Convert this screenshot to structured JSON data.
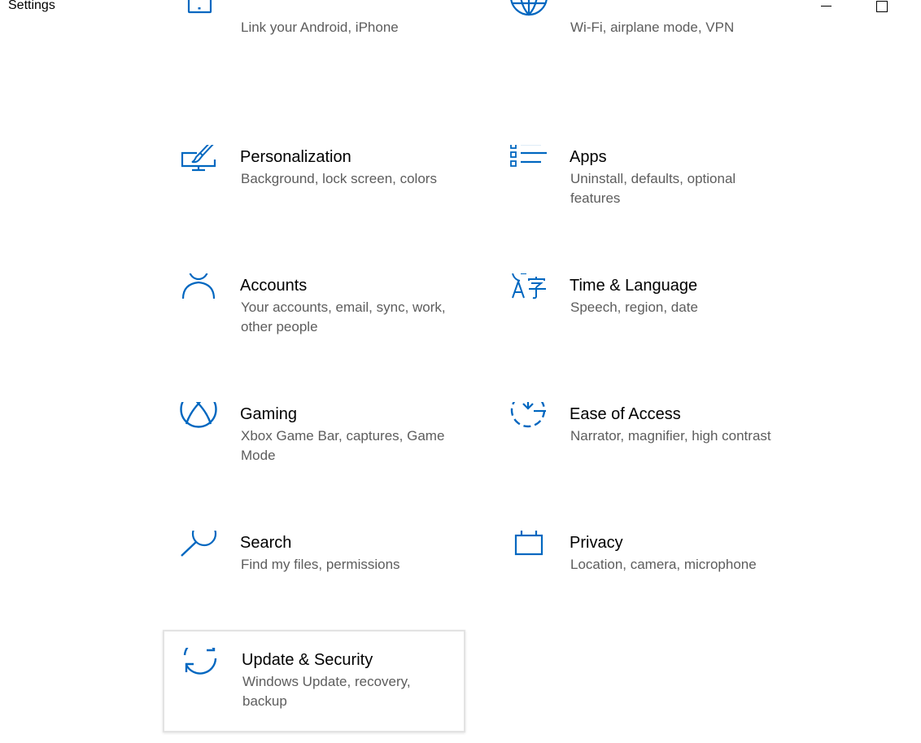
{
  "window": {
    "title": "Settings"
  },
  "accent_color": "#0067c0",
  "tiles": [
    {
      "title": "",
      "description": "Link your Android, iPhone",
      "icon": "phone-icon"
    },
    {
      "title": "",
      "description": "Wi-Fi, airplane mode, VPN",
      "icon": "globe-icon"
    },
    {
      "title": "Personalization",
      "description": "Background, lock screen, colors",
      "icon": "paint-brush-monitor-icon"
    },
    {
      "title": "Apps",
      "description": "Uninstall, defaults, optional features",
      "icon": "apps-list-icon"
    },
    {
      "title": "Accounts",
      "description": "Your accounts, email, sync, work, other people",
      "icon": "person-icon"
    },
    {
      "title": "Time & Language",
      "description": "Speech, region, date",
      "icon": "time-language-icon"
    },
    {
      "title": "Gaming",
      "description": "Xbox Game Bar, captures, Game Mode",
      "icon": "xbox-icon"
    },
    {
      "title": "Ease of Access",
      "description": "Narrator, magnifier, high contrast",
      "icon": "ease-of-access-icon"
    },
    {
      "title": "Search",
      "description": "Find my files, permissions",
      "icon": "search-icon"
    },
    {
      "title": "Privacy",
      "description": "Location, camera, microphone",
      "icon": "lock-icon"
    },
    {
      "title": "Update & Security",
      "description": "Windows Update, recovery, backup",
      "icon": "sync-arrows-icon"
    }
  ]
}
